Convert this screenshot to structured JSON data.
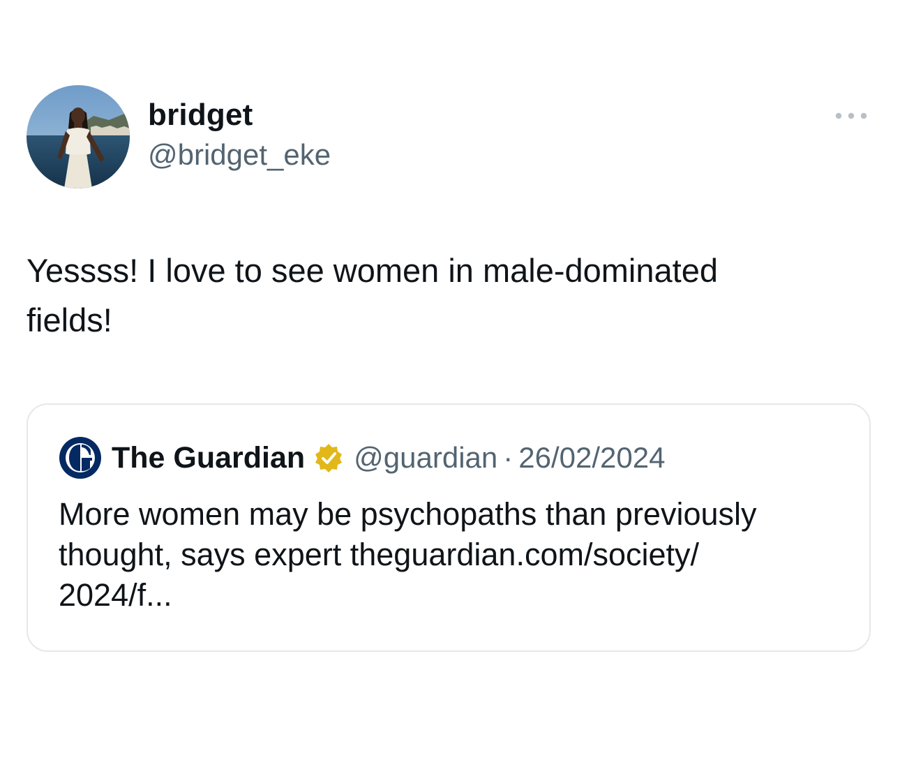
{
  "author": {
    "display_name": "bridget",
    "handle": "@bridget_eke",
    "avatar_icon": "profile-photo"
  },
  "more_icon": "more-horizontal-icon",
  "tweet": {
    "text_line1": "Yessss! I love to see women in male-dominated",
    "text_line2": "fields!"
  },
  "quote": {
    "source_name": "The Guardian",
    "source_logo_icon": "guardian-logo",
    "verified_icon": "verified-badge-icon",
    "handle": "@guardian",
    "separator": "·",
    "date": "26/02/2024",
    "text_line1": "More women may be psychopaths than previously",
    "text_line2": "thought, says expert theguardian.com/society/",
    "text_line3": "2024/f..."
  },
  "colors": {
    "text": "#0f1419",
    "secondary": "#536471",
    "card_border": "#e4e8eb",
    "verified_gold": "#e2b719",
    "guardian_navy": "#052962"
  }
}
